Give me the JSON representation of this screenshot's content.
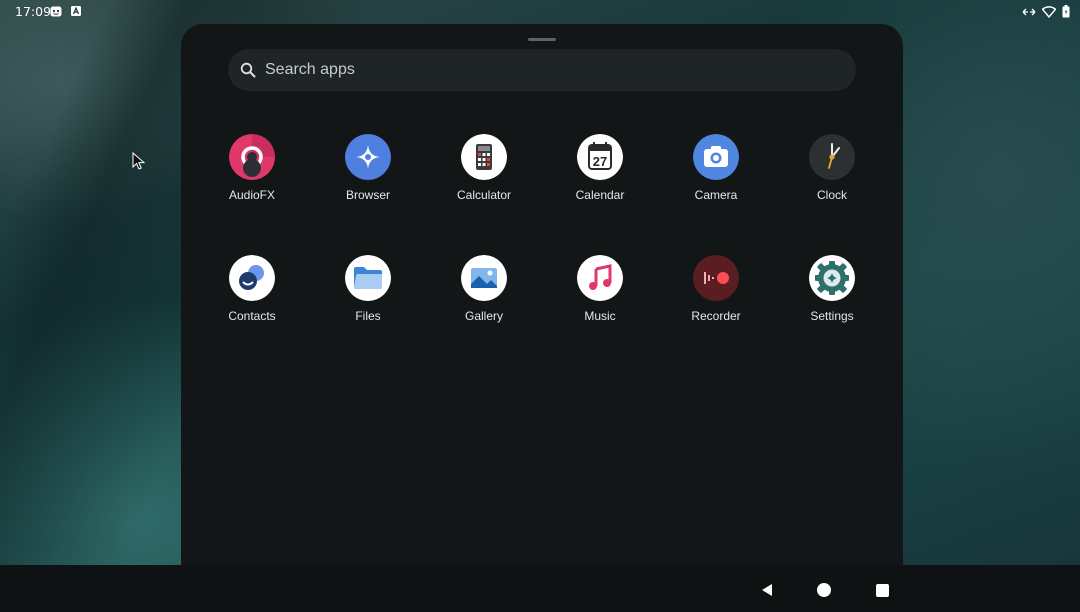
{
  "status_bar": {
    "time": "17:09",
    "left_icons": [
      "notification-face-icon",
      "app-notification-icon"
    ],
    "right_icons": [
      "data-transfer-icon",
      "wifi-icon",
      "battery-icon"
    ]
  },
  "drawer": {
    "search": {
      "placeholder": "Search apps",
      "icon": "search-icon"
    },
    "apps": [
      {
        "label": "AudioFX",
        "icon": "audiofx-icon",
        "color": "#e0386a"
      },
      {
        "label": "Browser",
        "icon": "browser-icon",
        "color": "#4f80e0"
      },
      {
        "label": "Calculator",
        "icon": "calculator-icon",
        "color": "#ffffff"
      },
      {
        "label": "Calendar",
        "icon": "calendar-icon",
        "color": "#ffffff",
        "day": "27"
      },
      {
        "label": "Camera",
        "icon": "camera-icon",
        "color": "#4f86e0"
      },
      {
        "label": "Clock",
        "icon": "clock-icon",
        "color": "#2b3030"
      },
      {
        "label": "Contacts",
        "icon": "contacts-icon",
        "color": "#ffffff"
      },
      {
        "label": "Files",
        "icon": "files-icon",
        "color": "#ffffff"
      },
      {
        "label": "Gallery",
        "icon": "gallery-icon",
        "color": "#ffffff"
      },
      {
        "label": "Music",
        "icon": "music-icon",
        "color": "#ffffff"
      },
      {
        "label": "Recorder",
        "icon": "recorder-icon",
        "color": "#5a1e22"
      },
      {
        "label": "Settings",
        "icon": "settings-icon",
        "color": "#ffffff"
      }
    ]
  },
  "nav_bar": {
    "buttons": [
      "back-icon",
      "home-icon",
      "recents-icon"
    ]
  }
}
